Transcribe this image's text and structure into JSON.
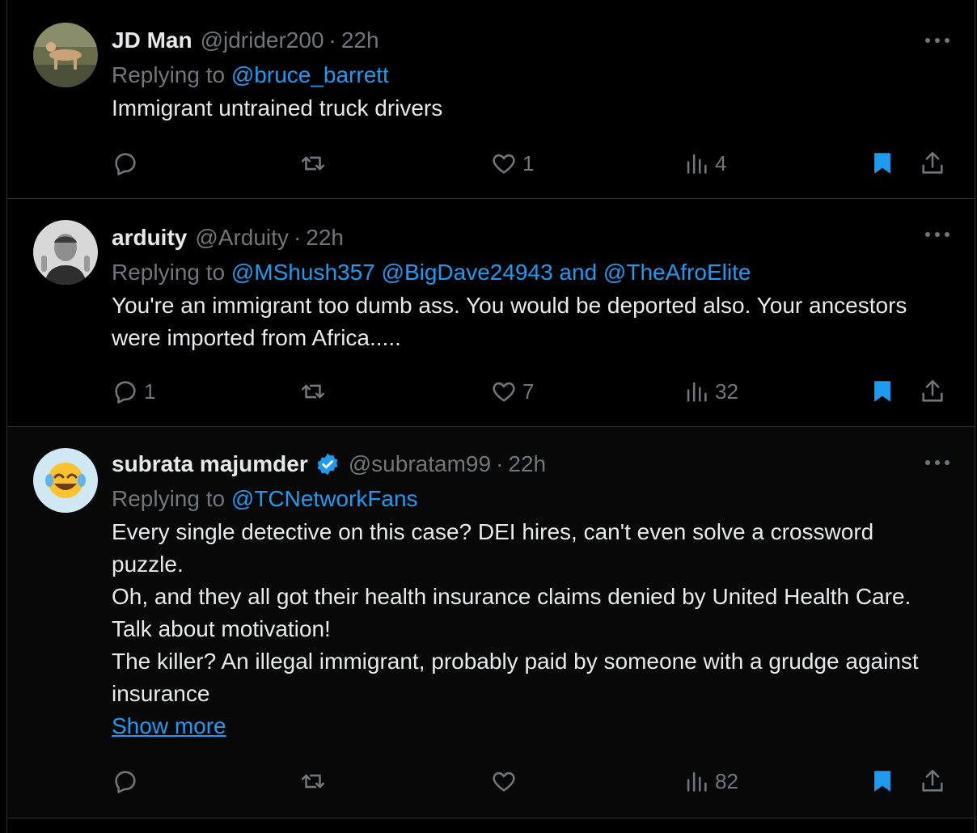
{
  "colors": {
    "background": "#000000",
    "text": "#e7e9ea",
    "muted": "#71767b",
    "accent": "#1d9bf0",
    "border": "#2f3336",
    "bookmark_active": "#1d9bf0"
  },
  "tweets": [
    {
      "name": "JD Man",
      "handle": "@jdrider200",
      "dot": "·",
      "time": "22h",
      "replying_prefix": "Replying to",
      "mentions": [
        "@bruce_barrett"
      ],
      "body": [
        "Immigrant untrained truck drivers"
      ],
      "reply_count": "",
      "retweet_count": "",
      "like_count": "1",
      "view_count": "4",
      "bookmarked": true
    },
    {
      "name": "arduity",
      "handle": "@Arduity",
      "dot": "·",
      "time": "22h",
      "replying_prefix": "Replying to",
      "mentions": [
        "@MShush357",
        "@BigDave24943",
        "and",
        "@TheAfroElite"
      ],
      "body": [
        "You're an immigrant too dumb ass. You would be deported also. Your ancestors were imported from Africa....."
      ],
      "reply_count": "1",
      "retweet_count": "",
      "like_count": "7",
      "view_count": "32",
      "bookmarked": true
    },
    {
      "name": "subrata majumder",
      "handle": "@subratam99",
      "dot": "·",
      "time": "22h",
      "verified": true,
      "replying_prefix": "Replying to",
      "mentions": [
        "@TCNetworkFans"
      ],
      "body": [
        "Every single detective on this case? DEI hires, can't even solve a crossword puzzle.",
        "Oh, and they all got their health insurance claims denied by United Health Care. Talk about motivation!",
        "The killer? An illegal immigrant, probably paid by someone with a grudge against insurance"
      ],
      "show_more": "Show more",
      "reply_count": "",
      "retweet_count": "",
      "like_count": "",
      "view_count": "82",
      "bookmarked": true
    }
  ],
  "icons": {
    "reply": "reply-icon",
    "retweet": "retweet-icon",
    "like": "heart-icon",
    "views": "views-icon",
    "bookmark": "bookmark-icon",
    "share": "share-icon",
    "more": "more-dots-icon",
    "verified": "verified-badge-icon"
  }
}
